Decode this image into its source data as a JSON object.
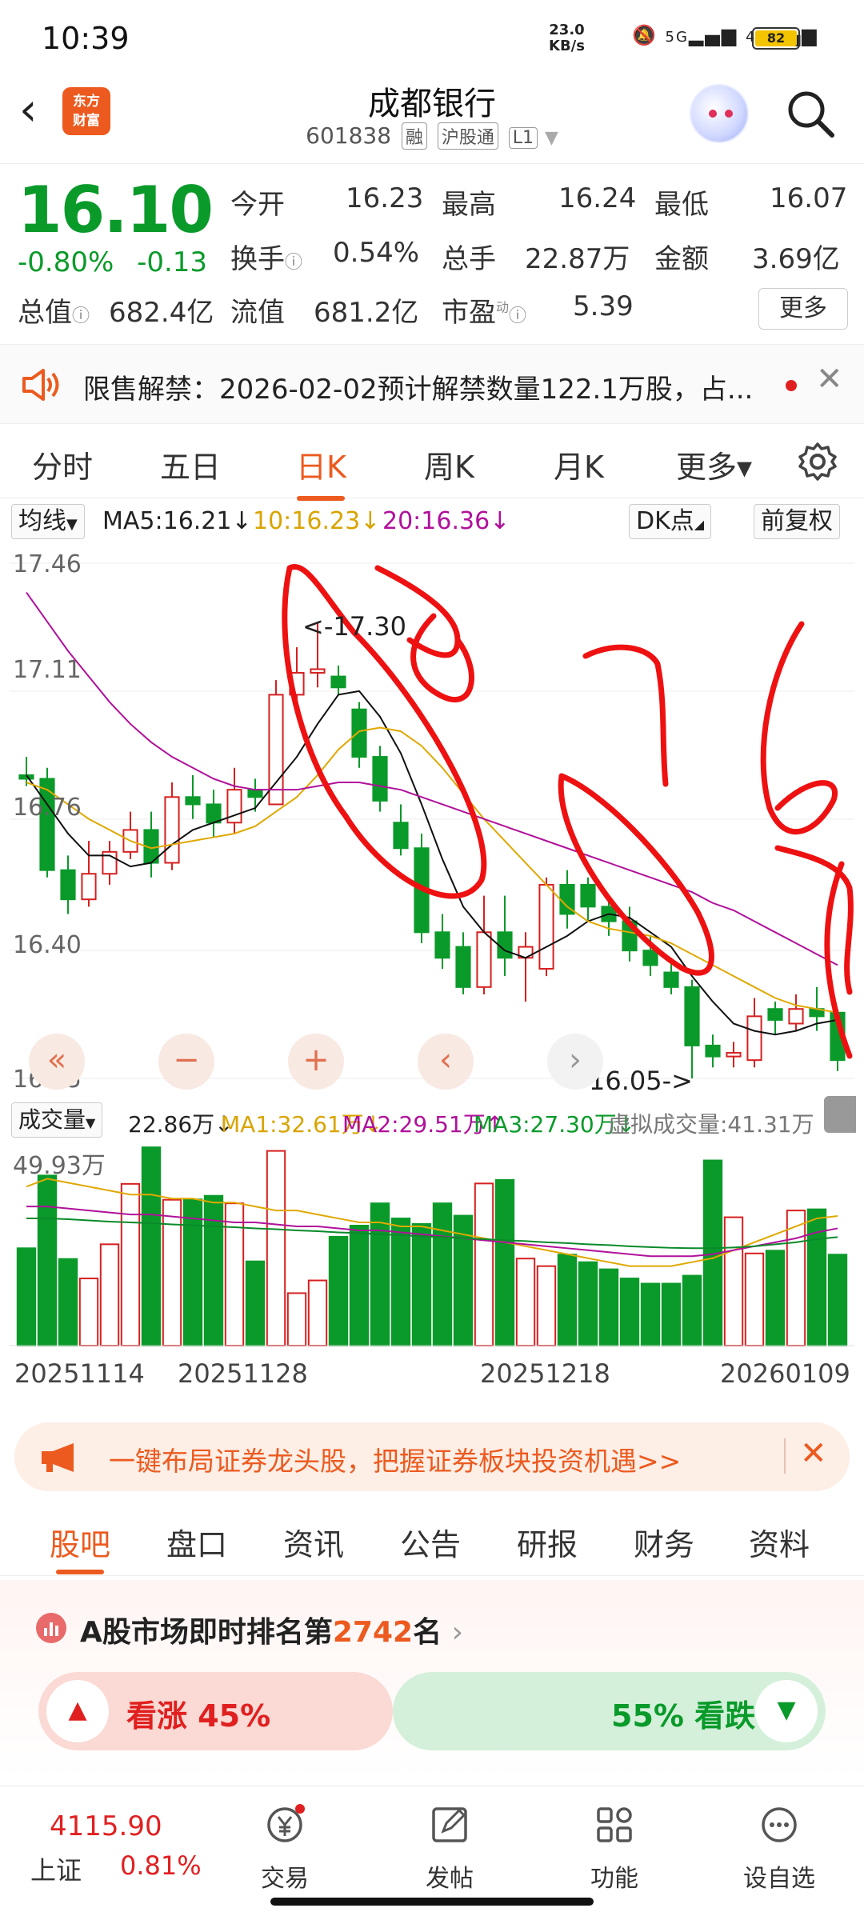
{
  "status_bar": {
    "time": "10:39",
    "net_speed": "23.0",
    "net_unit": "KB/s",
    "signal1": "5G",
    "signal2": "4G",
    "battery": "82"
  },
  "header": {
    "logo_line1": "东方",
    "logo_line2": "财富",
    "stock_name": "成都银行",
    "stock_code": "601838",
    "tags": [
      "融",
      "沪股通",
      "L1"
    ]
  },
  "quote": {
    "price": "16.10",
    "change_pct": "-0.80%",
    "change": "-0.13",
    "open_label": "今开",
    "open": "16.23",
    "high_label": "最高",
    "high": "16.24",
    "low_label": "最低",
    "low": "16.07",
    "turnover_label": "换手",
    "turnover": "0.54%",
    "volume_label": "总手",
    "volume": "22.87万",
    "amount_label": "金额",
    "amount": "3.69亿",
    "mktcap_label": "总值",
    "mktcap": "682.4亿",
    "float_label": "流值",
    "float": "681.2亿",
    "pe_label": "市盈",
    "pe_sup": "动",
    "pe": "5.39",
    "more": "更多"
  },
  "notice": {
    "text": "限售解禁：2026-02-02预计解禁数量122.1万股，占..."
  },
  "period_tabs": [
    {
      "label": "分时"
    },
    {
      "label": "五日"
    },
    {
      "label": "日K"
    },
    {
      "label": "周K"
    },
    {
      "label": "月K"
    },
    {
      "label": "更多▾"
    }
  ],
  "ma_legend": {
    "selector": "均线",
    "ma5": "MA5:16.21↓",
    "ma10": "10:16.23↓",
    "ma20": "20:16.36↓",
    "dk": "DK点",
    "adjust": "前复权"
  },
  "kline": {
    "y_labels": [
      "17.46",
      "17.11",
      "16.76",
      "16.40",
      "16.05"
    ],
    "high_marker": "<-17.30",
    "low_marker": "16.05->"
  },
  "volume": {
    "selector": "成交量",
    "vol": "22.86万↓",
    "ma1": "MA1:32.61万↓",
    "ma2": "MA2:29.51万↑",
    "ma3": "MA3:27.30万↓",
    "virtual": "虚拟成交量:41.31万",
    "max_label": "49.93万"
  },
  "dates": [
    "20251114",
    "20251128",
    "20251218",
    "20260109"
  ],
  "banner": {
    "text": "一键布局证券龙头股，把握证券板块投资机遇>>"
  },
  "section_tabs": [
    {
      "label": "股吧"
    },
    {
      "label": "盘口"
    },
    {
      "label": "资讯"
    },
    {
      "label": "公告"
    },
    {
      "label": "研报"
    },
    {
      "label": "财务"
    },
    {
      "label": "资料"
    }
  ],
  "ranking": {
    "prefix": "A股市场即时排名第",
    "rank": "2742",
    "suffix": "名"
  },
  "vote": {
    "up_label": "看涨 45%",
    "down_label": "55% 看跌",
    "up_ratio": 0.45
  },
  "bottom_nav": {
    "index_value": "4115.90",
    "index_name": "上证",
    "index_change": "0.81%",
    "items": [
      {
        "label": "交易"
      },
      {
        "label": "发帖"
      },
      {
        "label": "功能"
      },
      {
        "label": "设自选"
      }
    ]
  },
  "chart_data": {
    "type": "candlestick",
    "candles": [
      {
        "o": 16.88,
        "c": 16.87,
        "h": 16.93,
        "l": 16.85
      },
      {
        "o": 16.87,
        "c": 16.62,
        "h": 16.9,
        "l": 16.6
      },
      {
        "o": 16.62,
        "c": 16.54,
        "h": 16.66,
        "l": 16.5
      },
      {
        "o": 16.54,
        "c": 16.61,
        "h": 16.7,
        "l": 16.52
      },
      {
        "o": 16.61,
        "c": 16.67,
        "h": 16.7,
        "l": 16.58
      },
      {
        "o": 16.67,
        "c": 16.73,
        "h": 16.78,
        "l": 16.65
      },
      {
        "o": 16.73,
        "c": 16.64,
        "h": 16.78,
        "l": 16.6
      },
      {
        "o": 16.64,
        "c": 16.82,
        "h": 16.86,
        "l": 16.62
      },
      {
        "o": 16.82,
        "c": 16.8,
        "h": 16.88,
        "l": 16.76
      },
      {
        "o": 16.8,
        "c": 16.75,
        "h": 16.84,
        "l": 16.71
      },
      {
        "o": 16.75,
        "c": 16.84,
        "h": 16.9,
        "l": 16.72
      },
      {
        "o": 16.84,
        "c": 16.82,
        "h": 16.87,
        "l": 16.78
      },
      {
        "o": 16.8,
        "c": 17.1,
        "h": 17.14,
        "l": 16.8
      },
      {
        "o": 17.1,
        "c": 17.16,
        "h": 17.23,
        "l": 17.05
      },
      {
        "o": 17.16,
        "c": 17.17,
        "h": 17.3,
        "l": 17.12
      },
      {
        "o": 17.15,
        "c": 17.12,
        "h": 17.18,
        "l": 17.1
      },
      {
        "o": 17.06,
        "c": 16.93,
        "h": 17.08,
        "l": 16.9
      },
      {
        "o": 16.93,
        "c": 16.81,
        "h": 16.96,
        "l": 16.78
      },
      {
        "o": 16.75,
        "c": 16.68,
        "h": 16.8,
        "l": 16.66
      },
      {
        "o": 16.68,
        "c": 16.45,
        "h": 16.72,
        "l": 16.42
      },
      {
        "o": 16.45,
        "c": 16.38,
        "h": 16.5,
        "l": 16.35
      },
      {
        "o": 16.41,
        "c": 16.3,
        "h": 16.45,
        "l": 16.28
      },
      {
        "o": 16.3,
        "c": 16.45,
        "h": 16.55,
        "l": 16.28
      },
      {
        "o": 16.45,
        "c": 16.38,
        "h": 16.55,
        "l": 16.33
      },
      {
        "o": 16.38,
        "c": 16.41,
        "h": 16.45,
        "l": 16.26
      },
      {
        "o": 16.35,
        "c": 16.58,
        "h": 16.6,
        "l": 16.33
      },
      {
        "o": 16.58,
        "c": 16.5,
        "h": 16.62,
        "l": 16.46
      },
      {
        "o": 16.58,
        "c": 16.52,
        "h": 16.6,
        "l": 16.48
      },
      {
        "o": 16.52,
        "c": 16.48,
        "h": 16.55,
        "l": 16.44
      },
      {
        "o": 16.48,
        "c": 16.4,
        "h": 16.52,
        "l": 16.37
      },
      {
        "o": 16.4,
        "c": 16.36,
        "h": 16.44,
        "l": 16.33
      },
      {
        "o": 16.34,
        "c": 16.3,
        "h": 16.38,
        "l": 16.28
      },
      {
        "o": 16.3,
        "c": 16.14,
        "h": 16.32,
        "l": 16.05
      },
      {
        "o": 16.14,
        "c": 16.11,
        "h": 16.17,
        "l": 16.08
      },
      {
        "o": 16.11,
        "c": 16.12,
        "h": 16.15,
        "l": 16.08
      },
      {
        "o": 16.1,
        "c": 16.22,
        "h": 16.27,
        "l": 16.08
      },
      {
        "o": 16.24,
        "c": 16.21,
        "h": 16.26,
        "l": 16.17
      },
      {
        "o": 16.2,
        "c": 16.24,
        "h": 16.28,
        "l": 16.18
      },
      {
        "o": 16.24,
        "c": 16.22,
        "h": 16.3,
        "l": 16.18
      },
      {
        "o": 16.23,
        "c": 16.1,
        "h": 16.24,
        "l": 16.07
      }
    ],
    "ma5": [
      16.88,
      16.8,
      16.72,
      16.66,
      16.66,
      16.63,
      16.64,
      16.69,
      16.73,
      16.75,
      16.77,
      16.79,
      16.86,
      16.93,
      17.02,
      17.1,
      17.11,
      17.04,
      16.94,
      16.8,
      16.65,
      16.52,
      16.45,
      16.4,
      16.38,
      16.41,
      16.44,
      16.48,
      16.5,
      16.49,
      16.45,
      16.41,
      16.33,
      16.26,
      16.2,
      16.18,
      16.17,
      16.18,
      16.2,
      16.21
    ],
    "ma10": [
      16.86,
      16.84,
      16.8,
      16.76,
      16.73,
      16.7,
      16.68,
      16.69,
      16.7,
      16.71,
      16.72,
      16.74,
      16.78,
      16.82,
      16.88,
      16.95,
      17.0,
      17.01,
      17.0,
      16.96,
      16.9,
      16.83,
      16.76,
      16.7,
      16.64,
      16.58,
      16.52,
      16.48,
      16.46,
      16.45,
      16.44,
      16.42,
      16.39,
      16.36,
      16.33,
      16.3,
      16.27,
      16.25,
      16.24,
      16.23
    ],
    "ma20": [
      17.38,
      17.3,
      17.22,
      17.15,
      17.08,
      17.02,
      16.97,
      16.93,
      16.9,
      16.87,
      16.85,
      16.84,
      16.84,
      16.84,
      16.85,
      16.86,
      16.86,
      16.85,
      16.84,
      16.82,
      16.8,
      16.78,
      16.76,
      16.74,
      16.72,
      16.7,
      16.68,
      16.66,
      16.64,
      16.62,
      16.6,
      16.58,
      16.56,
      16.53,
      16.51,
      16.48,
      16.45,
      16.42,
      16.39,
      16.36
    ],
    "volumes": [
      24.5,
      42.8,
      21.8,
      16.9,
      25.5,
      40.7,
      49.9,
      36.7,
      36.8,
      37.7,
      35.8,
      21.2,
      49.0,
      13.2,
      16.4,
      27.4,
      30.2,
      35.8,
      32.0,
      30.6,
      35.8,
      32.7,
      40.8,
      41.7,
      21.9,
      20.0,
      22.9,
      21.0,
      19.2,
      16.9,
      15.6,
      15.6,
      17.6,
      46.6,
      32.3,
      23.2,
      23.9,
      34.0,
      34.3,
      22.9
    ],
    "vol_ma1": [
      40,
      42,
      41,
      40,
      39,
      38,
      38,
      37,
      37,
      36,
      36,
      35,
      34,
      34,
      33,
      32,
      31,
      31,
      30,
      30,
      29,
      28,
      27,
      26,
      25,
      24,
      23,
      22,
      21,
      20,
      20,
      20,
      21,
      22,
      24,
      26,
      28,
      30,
      32,
      32.61
    ],
    "vol_ma2": [
      35,
      35,
      34.5,
      34,
      33.5,
      33,
      33,
      32.5,
      32,
      31.5,
      31,
      31,
      30.5,
      30,
      30,
      29.5,
      29,
      29,
      28.5,
      28,
      27.5,
      27,
      26.5,
      26,
      25.5,
      25,
      24.5,
      24,
      23.5,
      23,
      22.5,
      22.5,
      22.5,
      23,
      24,
      25,
      26,
      27,
      28.5,
      29.51
    ],
    "vol_ma3": [
      32,
      32,
      31.8,
      31.5,
      31.2,
      31,
      30.8,
      30.5,
      30.3,
      30,
      29.8,
      29.5,
      29.3,
      29,
      28.8,
      28.5,
      28.3,
      28,
      27.8,
      27.5,
      27.3,
      27,
      26.8,
      26.5,
      26.3,
      26,
      25.8,
      25.5,
      25.3,
      25,
      24.8,
      24.6,
      24.5,
      24.5,
      24.7,
      25,
      25.5,
      26,
      26.8,
      27.3
    ],
    "y_range": [
      16.05,
      17.46
    ],
    "vol_max": 49.93
  }
}
